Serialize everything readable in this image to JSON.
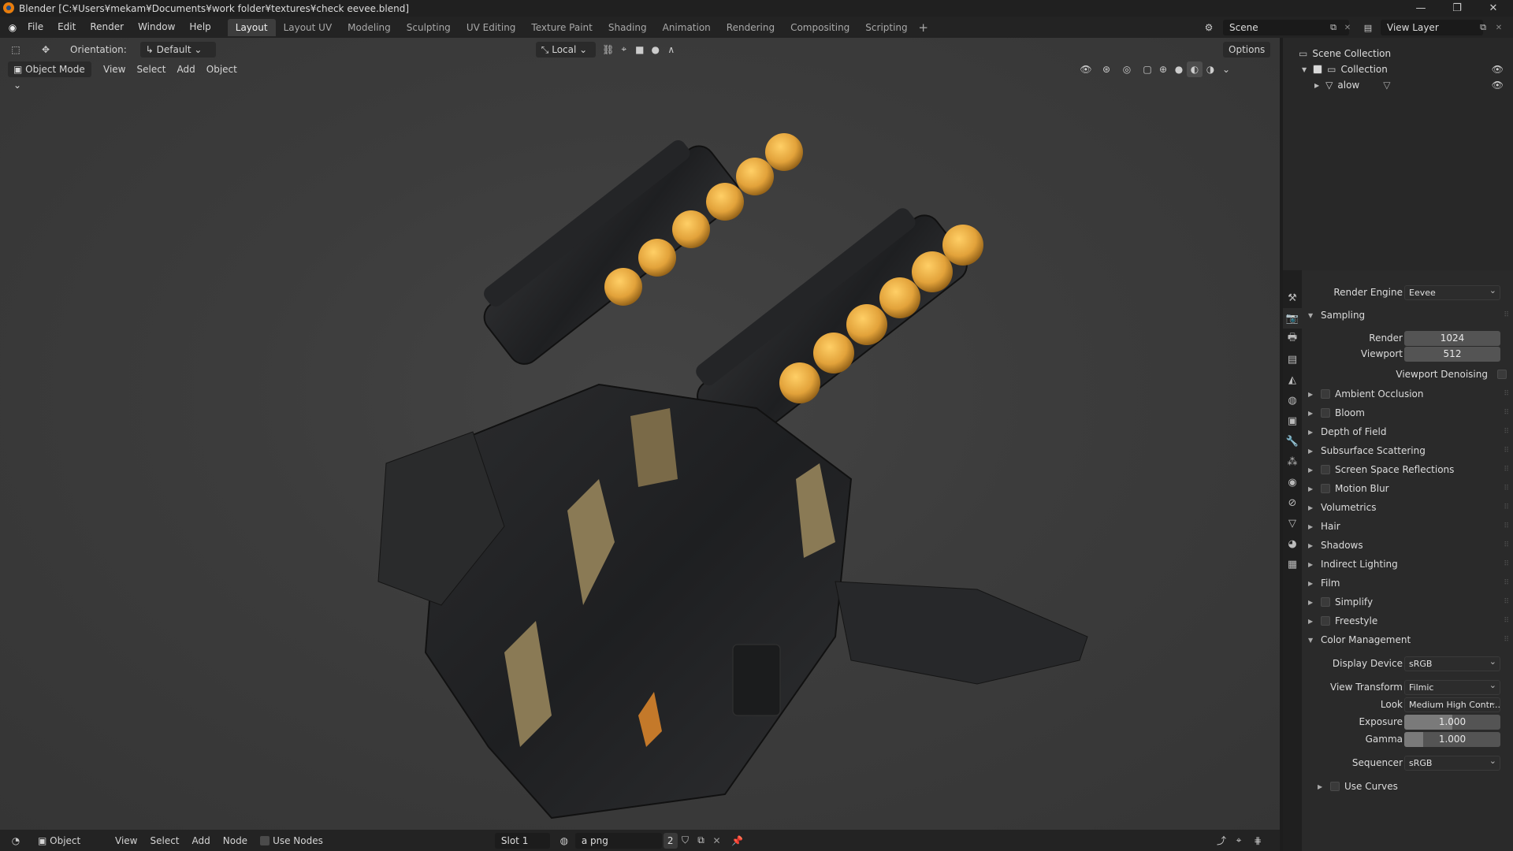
{
  "window": {
    "title": "Blender [C:¥Users¥mekam¥Documents¥work folder¥textures¥check eevee.blend]",
    "minimize": "—",
    "maximize": "❐",
    "close": "✕"
  },
  "menu": [
    "File",
    "Edit",
    "Render",
    "Window",
    "Help"
  ],
  "workspaces": [
    {
      "label": "Layout",
      "active": true
    },
    {
      "label": "Layout UV",
      "active": false
    },
    {
      "label": "Modeling",
      "active": false
    },
    {
      "label": "Sculpting",
      "active": false
    },
    {
      "label": "UV Editing",
      "active": false
    },
    {
      "label": "Texture Paint",
      "active": false
    },
    {
      "label": "Shading",
      "active": false
    },
    {
      "label": "Animation",
      "active": false
    },
    {
      "label": "Rendering",
      "active": false
    },
    {
      "label": "Compositing",
      "active": false
    },
    {
      "label": "Scripting",
      "active": false
    }
  ],
  "workspace_add": "+",
  "scene": "Scene",
  "view_layer": "View Layer",
  "viewport": {
    "orientation_label": "Orientation:",
    "orientation_value": "Default",
    "pivot": "Local",
    "options": "Options",
    "mode": "Object Mode",
    "menus": [
      "View",
      "Select",
      "Add",
      "Object"
    ]
  },
  "bottom": {
    "mode": "Object",
    "menus": [
      "View",
      "Select",
      "Add",
      "Node"
    ],
    "use_nodes": "Use Nodes",
    "slot": "Slot 1",
    "image": "a png",
    "users": "2"
  },
  "outliner": {
    "root": "Scene Collection",
    "collection": "Collection",
    "object": "alow"
  },
  "properties": {
    "render_engine_label": "Render Engine",
    "render_engine": "Eevee",
    "sampling": "Sampling",
    "render_label": "Render",
    "render_value": "1024",
    "viewport_label": "Viewport",
    "viewport_value": "512",
    "viewport_denoising": "Viewport Denoising",
    "sections": [
      {
        "label": "Ambient Occlusion",
        "checkbox": true
      },
      {
        "label": "Bloom",
        "checkbox": true
      },
      {
        "label": "Depth of Field",
        "checkbox": false
      },
      {
        "label": "Subsurface Scattering",
        "checkbox": false
      },
      {
        "label": "Screen Space Reflections",
        "checkbox": true
      },
      {
        "label": "Motion Blur",
        "checkbox": true
      },
      {
        "label": "Volumetrics",
        "checkbox": false
      },
      {
        "label": "Hair",
        "checkbox": false
      },
      {
        "label": "Shadows",
        "checkbox": false
      },
      {
        "label": "Indirect Lighting",
        "checkbox": false
      },
      {
        "label": "Film",
        "checkbox": false
      },
      {
        "label": "Simplify",
        "checkbox": true
      },
      {
        "label": "Freestyle",
        "checkbox": true
      }
    ],
    "color_management": "Color Management",
    "display_device_label": "Display Device",
    "display_device": "sRGB",
    "view_transform_label": "View Transform",
    "view_transform": "Filmic",
    "look_label": "Look",
    "look": "Medium High Contr...",
    "exposure_label": "Exposure",
    "exposure": "1.000",
    "gamma_label": "Gamma",
    "gamma": "1.000",
    "sequencer_label": "Sequencer",
    "sequencer": "sRGB",
    "use_curves": "Use Curves"
  }
}
